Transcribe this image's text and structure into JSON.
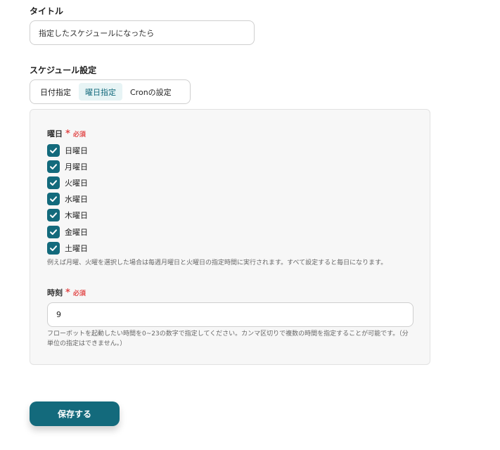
{
  "title_field": {
    "label": "タイトル",
    "value": "指定したスケジュールになったら"
  },
  "schedule": {
    "label": "スケジュール設定",
    "tabs": [
      {
        "label": "日付指定",
        "active": false
      },
      {
        "label": "曜日指定",
        "active": true
      },
      {
        "label": "Cronの設定",
        "active": false
      }
    ]
  },
  "weekday": {
    "label": "曜日",
    "required_star": "*",
    "required_text": "必須",
    "options": [
      {
        "label": "日曜日",
        "checked": true
      },
      {
        "label": "月曜日",
        "checked": true
      },
      {
        "label": "火曜日",
        "checked": true
      },
      {
        "label": "水曜日",
        "checked": true
      },
      {
        "label": "木曜日",
        "checked": true
      },
      {
        "label": "金曜日",
        "checked": true
      },
      {
        "label": "土曜日",
        "checked": true
      }
    ],
    "hint": "例えば月曜、火曜を選択した場合は毎週月曜日と火曜日の指定時間に実行されます。すべて設定すると毎日になります。"
  },
  "hour": {
    "label": "時刻",
    "required_star": "*",
    "required_text": "必須",
    "value": "9",
    "hint_line1": "フローボットを起動したい時間を0~23の数字で指定してください。カンマ区切りで複数の時間を指定することが可能です。（分",
    "hint_line2": "単位の指定はできません。）"
  },
  "actions": {
    "save_label": "保存する"
  },
  "colors": {
    "accent": "#136a7c",
    "active_tab_bg": "#e7f4f5",
    "required": "#e24b4b",
    "panel_bg": "#f7f7f7"
  }
}
